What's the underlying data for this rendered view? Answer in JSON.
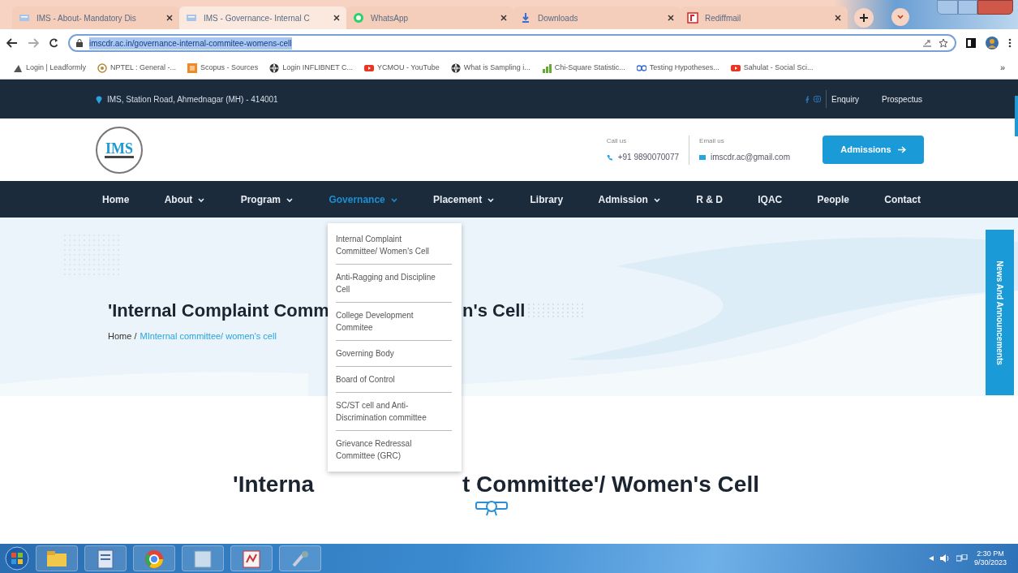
{
  "browser": {
    "tabs": [
      {
        "title": "IMS - About- Mandatory Dis",
        "selected": false
      },
      {
        "title": "IMS - Governance- Internal C",
        "selected": true
      },
      {
        "title": "WhatsApp",
        "selected": false
      },
      {
        "title": "Downloads",
        "selected": false
      },
      {
        "title": "Rediffmail",
        "selected": false
      }
    ],
    "url": "imscdr.ac.in/governance-internal-commitee-womens-cell",
    "bookmarks": [
      "Login | Leadformly",
      "NPTEL : General -...",
      "Scopus - Sources",
      "Login INFLIBNET C...",
      "YCMOU - YouTube",
      "What is Sampling i...",
      "Chi-Square Statistic...",
      "Testing Hypotheses...",
      "Sahulat - Social Sci..."
    ],
    "bookmarks_more": "»"
  },
  "topbar": {
    "address": "IMS, Station Road, Ahmednagar (MH) - 414001",
    "links": [
      "Enquiry",
      "Prospectus"
    ]
  },
  "header": {
    "logo": "IMS",
    "call_label": "Call us",
    "phone": "+91 9890070077",
    "email_label": "Email us",
    "email": "imscdr.ac@gmail.com",
    "cta": "Admissions"
  },
  "nav": [
    {
      "label": "Home",
      "dropdown": false,
      "selected": false
    },
    {
      "label": "About",
      "dropdown": true,
      "selected": false
    },
    {
      "label": "Program",
      "dropdown": true,
      "selected": false
    },
    {
      "label": "Governance",
      "dropdown": true,
      "selected": true
    },
    {
      "label": "Placement",
      "dropdown": true,
      "selected": false
    },
    {
      "label": "Library",
      "dropdown": false,
      "selected": false
    },
    {
      "label": "Admission",
      "dropdown": true,
      "selected": false
    },
    {
      "label": "R & D",
      "dropdown": false,
      "selected": false
    },
    {
      "label": "IQAC",
      "dropdown": false,
      "selected": false
    },
    {
      "label": "People",
      "dropdown": false,
      "selected": false
    },
    {
      "label": "Contact",
      "dropdown": false,
      "selected": false
    }
  ],
  "dropdown": [
    "Internal Complaint Committee/ Women's Cell",
    "Anti-Ragging and Discipline Cell",
    "College Development Commitee",
    "Governing Body",
    "Board of Control",
    "SC/ST cell and Anti-Discrimination committee",
    "Grievance Redressal Committee (GRC)"
  ],
  "hero": {
    "title_parts": [
      "'Internal Complaint Comm",
      "n's Cell"
    ],
    "breadcrumb_home": "Home /",
    "breadcrumb_current": "MInternal committee/ women's cell"
  },
  "side_tab": "News And Announcements",
  "section": {
    "heading_parts": [
      "'Interna",
      "t Committee'/ Women's Cell"
    ]
  },
  "taskbar": {
    "time": "2:30 PM",
    "date": "9/30/2023"
  }
}
